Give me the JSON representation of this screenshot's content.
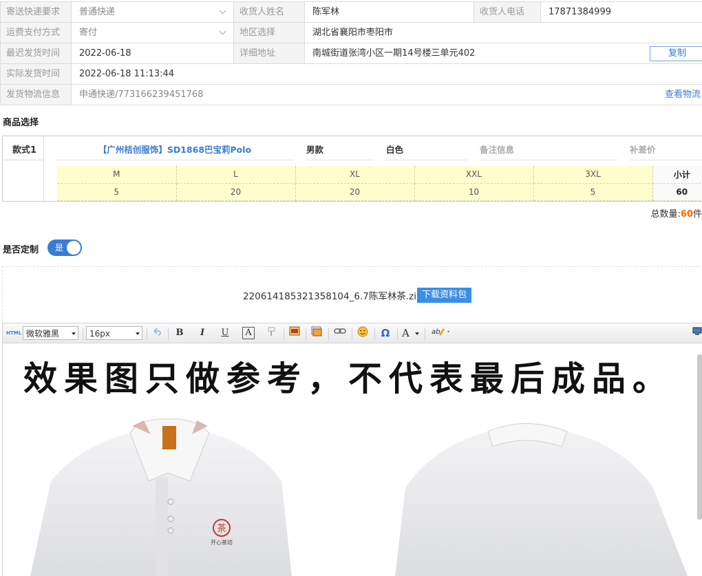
{
  "info": {
    "express_label": "寄送快递要求",
    "express_value": "普通快递",
    "receiver_name_label": "收货人姓名",
    "receiver_name": "陈军林",
    "receiver_phone_label": "收货人电话",
    "receiver_phone": "17871384999",
    "freight_label": "运费支付方式",
    "freight_value": "寄付",
    "region_label": "地区选择",
    "region_value": "湖北省襄阳市枣阳市",
    "latest_ship_label": "最迟发货时间",
    "latest_ship_value": "2022-06-18",
    "address_label": "详细地址",
    "address_value": "南城街道张湾小区一期14号楼三单元402",
    "copy_button": "复制",
    "actual_ship_label": "实际发货时间",
    "actual_ship_value": "2022-06-18 11:13:44",
    "logistics_label": "发货物流信息",
    "logistics_value": "申通快递/773166239451768",
    "view_logistics": "查看物流"
  },
  "product": {
    "section_title": "商品选择",
    "style_label": "款式1",
    "name": "【广州桔创服饰】SD1868巴宝莉Polo",
    "gender": "男款",
    "color": "白色",
    "remark_placeholder": "备注信息",
    "price_diff_placeholder": "补差价",
    "sizes": [
      {
        "size": "M",
        "qty": "5"
      },
      {
        "size": "L",
        "qty": "20"
      },
      {
        "size": "XL",
        "qty": "20"
      },
      {
        "size": "XXL",
        "qty": "10"
      },
      {
        "size": "3XL",
        "qty": "5"
      }
    ],
    "subtotal_label": "小计",
    "subtotal_value": "60",
    "total_label": "总数量:",
    "total_value": "60",
    "total_unit": "件"
  },
  "customize": {
    "label": "是否定制",
    "toggle_text": "是",
    "toggle_on": true
  },
  "file": {
    "name": "220614185321358104_6.7陈军林茶.zip",
    "download_button": "下载资料包"
  },
  "editor": {
    "html_label": "HTML",
    "font_family": "微软雅黑",
    "font_size": "16px",
    "bold": "B",
    "italic": "I",
    "underline": "U",
    "text_box": "A",
    "special_char": "Ω",
    "font_color": "A",
    "content_notice": "效果图只做参考，不代表最后成品。",
    "logo_text": "开心茶坊"
  },
  "colors": {
    "accent": "#3a7bd5",
    "highlight": "#ff6a00",
    "size_row_bg": "#fefdcc"
  }
}
